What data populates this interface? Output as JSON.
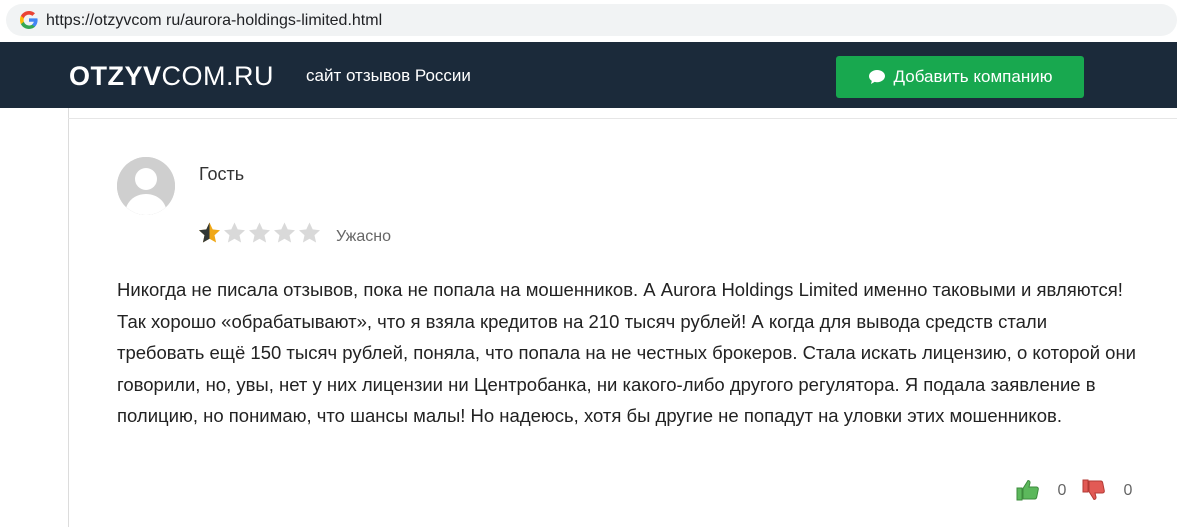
{
  "browser": {
    "url": "https://otzyvcom ru/aurora-holdings-limited.html",
    "search_icon": "google-g-icon"
  },
  "header": {
    "logo_bold": "OTZYV",
    "logo_light": "COM.RU",
    "tagline": "сайт отзывов России",
    "add_company_label": "Добавить компанию",
    "add_company_icon": "chat-bubble-icon",
    "background_color": "#1b2a3a",
    "button_color": "#18a84f"
  },
  "review": {
    "author": "Гость",
    "rating": 1,
    "rating_max": 5,
    "rating_label": "Ужасно",
    "text": "Никогда не писала отзывов, пока не попала на мошенников. А Aurora Holdings Limited именно таковыми и являются! Так хорошо «обрабатывают», что я взяла кредитов на 210 тысяч рублей! А когда для вывода средств стали требовать ещё 150 тысяч рублей, поняла, что попала на не честных брокеров. Стала искать лицензию, о которой они говорили, но, увы, нет у них лицензии ни Центробанка, ни какого-либо другого регулятора. Я подала заявление в полицию, но понимаю, что шансы малы! Но надеюсь, хотя бы другие не попадут на уловки этих мошенников.",
    "likes": "0",
    "dislikes": "0",
    "star_color": "#f0a818",
    "star_empty_color": "#d9d9d9"
  }
}
